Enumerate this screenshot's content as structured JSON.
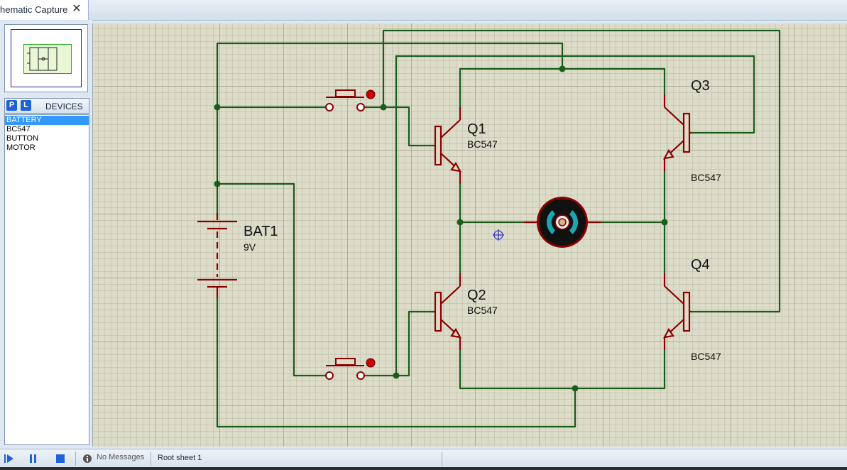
{
  "tab": {
    "title": "hematic Capture",
    "close_glyph": "✕"
  },
  "panel": {
    "pick_label": "P",
    "library_label": "L",
    "devices_title": "DEVICES",
    "devices": [
      "BATTERY",
      "BC547",
      "BUTTON",
      "MOTOR"
    ],
    "selected_device": "BATTERY"
  },
  "schematic": {
    "battery": {
      "ref": "BAT1",
      "value": "9V"
    },
    "transistors": [
      {
        "ref": "Q1",
        "value": "BC547"
      },
      {
        "ref": "Q2",
        "value": "BC547"
      },
      {
        "ref": "Q3",
        "value": "BC547"
      },
      {
        "ref": "Q4",
        "value": "BC547"
      }
    ],
    "colors": {
      "wire": "#1a5c1a",
      "component": "#8b0000",
      "motor_accent": "#1ba6b4",
      "grid_bg": "#dcdcc8",
      "cursor": "#3030c0"
    }
  },
  "statusbar": {
    "messages": "No Messages",
    "sheet": "Root sheet 1",
    "icons": [
      "play-icon",
      "pause-icon",
      "stop-icon",
      "info-icon"
    ]
  }
}
